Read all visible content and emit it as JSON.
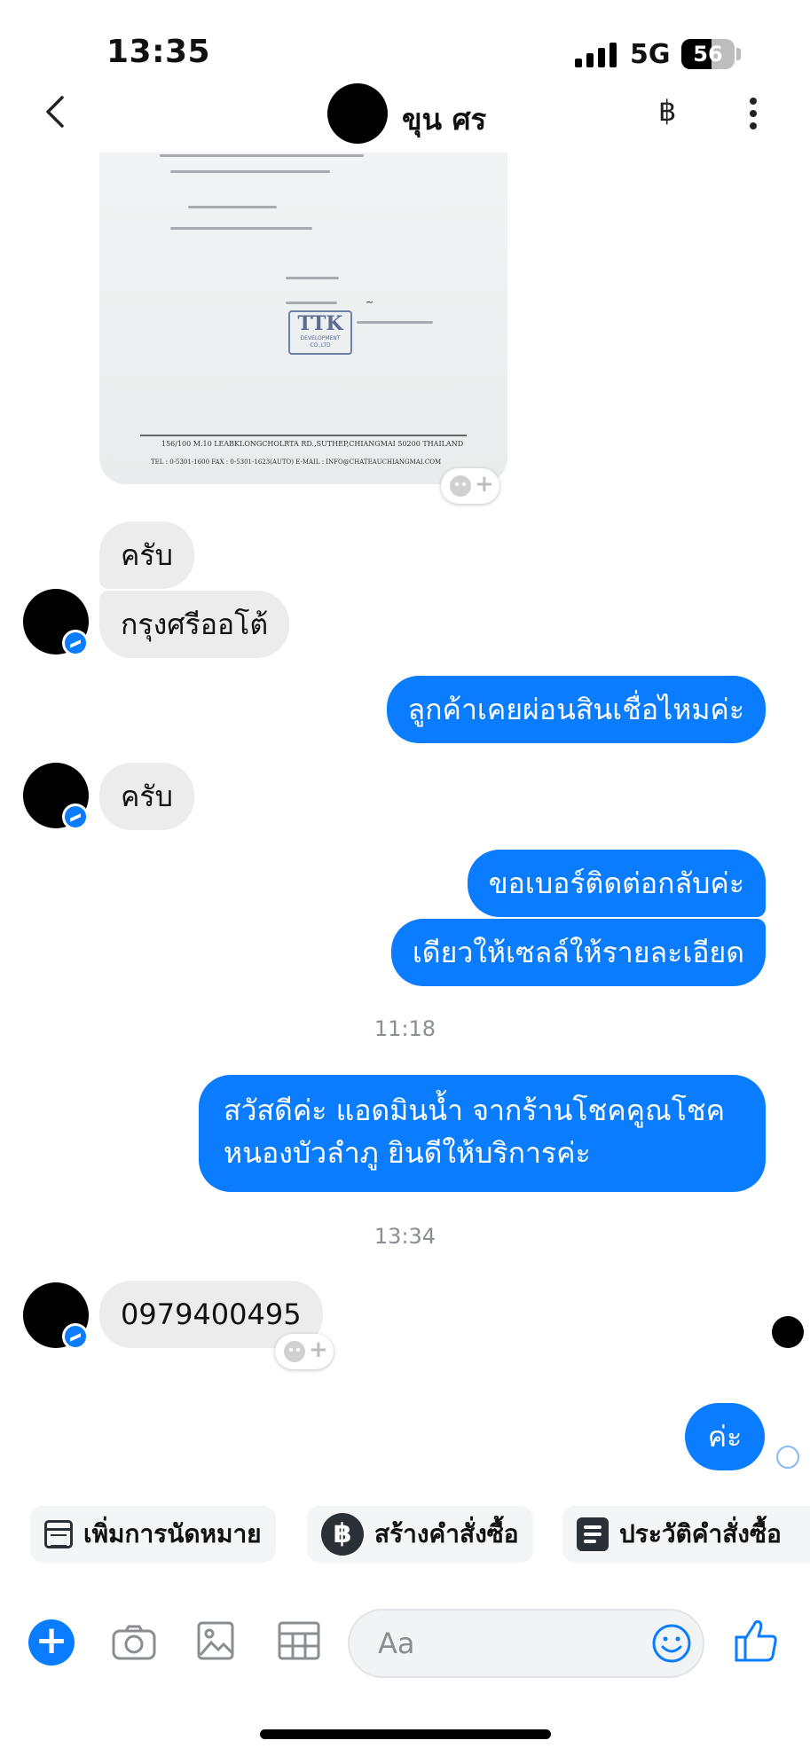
{
  "status_bar": {
    "time": "13:35",
    "network": "5G",
    "battery": "56"
  },
  "header": {
    "contact_name": "ขุน ศร",
    "baht_symbol": "฿"
  },
  "attachment": {
    "address": "156/100 M.10 LEABKLONGCHOLRTA RD.,SUTHEP,CHIANGMAI 50200 THAILAND",
    "tel": "TEL : 0-5301-1600 FAX : 0-5301-1623(AUTO)    E-MAIL : INFO@CHATEAUCHIANGMAI.COM",
    "stamp_logo": "TTK",
    "stamp_sub": "DEVELOPMENT CO.,LTD"
  },
  "messages": {
    "m1": "ครับ",
    "m2": "กรุงศรีออโต้",
    "m3": "ลูกค้าเคยผ่อนสินเชื่อไหมค่ะ",
    "m4": "ครับ",
    "m5": "ขอเบอร์ติดต่อกลับค่ะ",
    "m6": "เดียวให้เซลล์ให้รายละเอียด",
    "ts1": "11:18",
    "m7": "สวัสดีค่ะ แอดมินน้ำ จากร้านโชคคูณโชค หนองบัวลำภู ยินดีให้บริการค่ะ",
    "ts2": "13:34",
    "m8": "0979400495",
    "m9": "ค่ะ"
  },
  "quick_actions": {
    "appointment": "เพิ่มการนัดหมาย",
    "create_order": "สร้างคำสั่งซื้อ",
    "order_history": "ประวัติคำสั่งซื้อ",
    "baht_symbol": "฿"
  },
  "composer": {
    "placeholder": "Aa",
    "plus": "+"
  },
  "colors": {
    "accent": "#0a7cff",
    "incoming": "#ececec",
    "timestamp": "#8a8d91"
  }
}
